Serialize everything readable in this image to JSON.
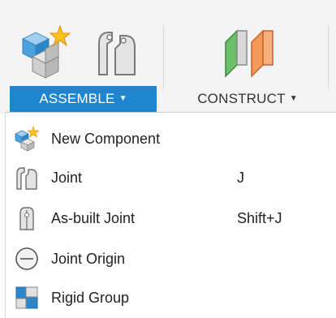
{
  "toolbar": {
    "groups": [
      {
        "label": "ASSEMBLE",
        "active": true
      },
      {
        "label": "CONSTRUCT",
        "active": false
      }
    ],
    "accent_color": "#1f85d1"
  },
  "menu": {
    "items": [
      {
        "label": "New Component",
        "shortcut": "",
        "icon": "new-component-icon"
      },
      {
        "label": "Joint",
        "shortcut": "J",
        "icon": "joint-icon"
      },
      {
        "label": "As-built Joint",
        "shortcut": "Shift+J",
        "icon": "as-built-joint-icon"
      },
      {
        "label": "Joint Origin",
        "shortcut": "",
        "icon": "joint-origin-icon"
      },
      {
        "label": "Rigid Group",
        "shortcut": "",
        "icon": "rigid-group-icon"
      }
    ]
  }
}
